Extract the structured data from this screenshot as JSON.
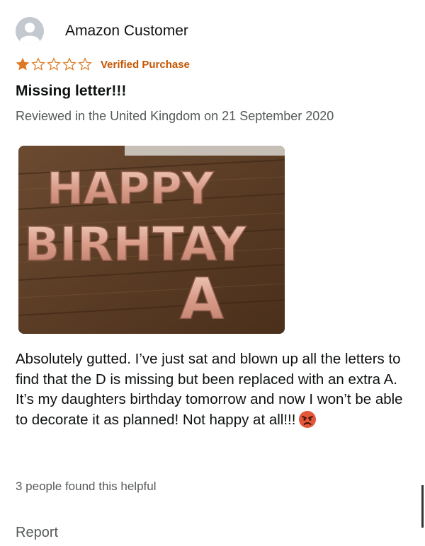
{
  "review": {
    "reviewer_name": "Amazon Customer",
    "rating": 1,
    "rating_max": 5,
    "verified_label": "Verified Purchase",
    "title": "Missing letter!!!",
    "date_line": "Reviewed in the United Kingdom on 21 September 2020",
    "photo": {
      "balloon_line1": "HAPPY",
      "balloon_line2": "BIRHTAY",
      "balloon_line3": "A"
    },
    "body": "Absolutely gutted. I’ve just sat and blown up all the letters to find that the D is missing but been replaced with an extra A. It’s my daughters birthday tomorrow and now I won’t be able to decorate it as planned! Not happy at all!!!",
    "emoji": "angry-face-icon",
    "helpful_text": "3 people found this helpful",
    "report_label": "Report"
  },
  "colors": {
    "verified": "#c45500",
    "star": "#de7921",
    "muted_text": "#565959",
    "balloon": "#e2b3a3"
  }
}
